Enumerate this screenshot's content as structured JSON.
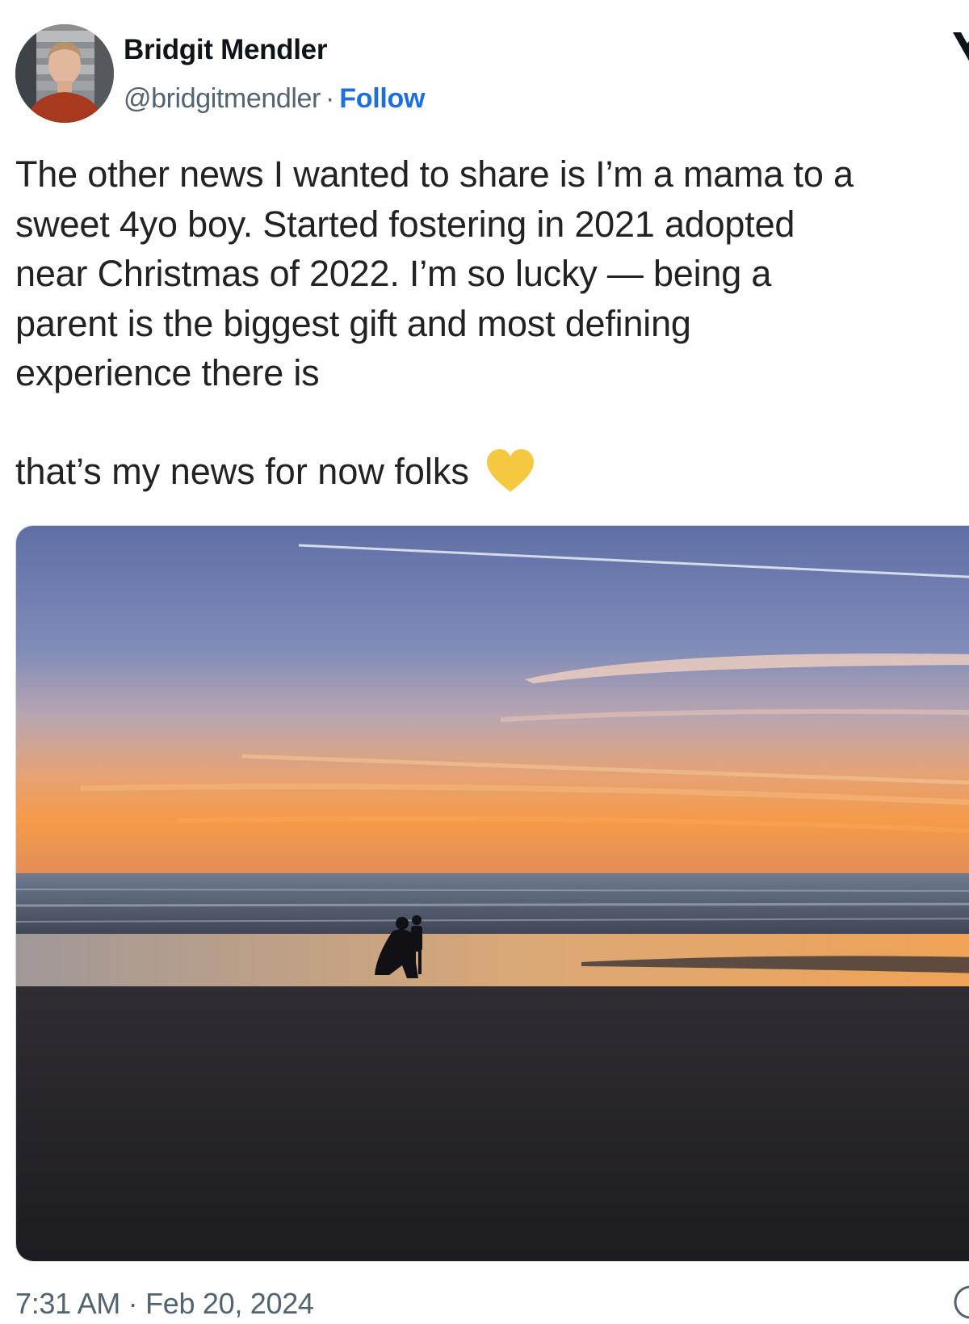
{
  "author": {
    "name": "Bridgit Mendler",
    "handle": "@bridgitmendler",
    "separator": "·",
    "follow_label": "Follow"
  },
  "tweet": {
    "lines": [
      "The other news I wanted to share is I’m a mama to a",
      "sweet 4yo boy. Started fostering in 2021 adopted",
      "near Christmas of 2022. I’m so lucky — being a",
      "parent is the biggest gift and most defining",
      "experience there is"
    ],
    "second_paragraph": "that’s my news for now folks",
    "emoji": "yellow-heart",
    "timestamp": "7:31 AM · Feb 20, 2024"
  },
  "icons": {
    "x_logo": "x-logo-icon",
    "info": "info-icon"
  },
  "colors": {
    "follow": "#1d6fe0",
    "secondary_text": "#536471",
    "heart": "#f5c842"
  }
}
